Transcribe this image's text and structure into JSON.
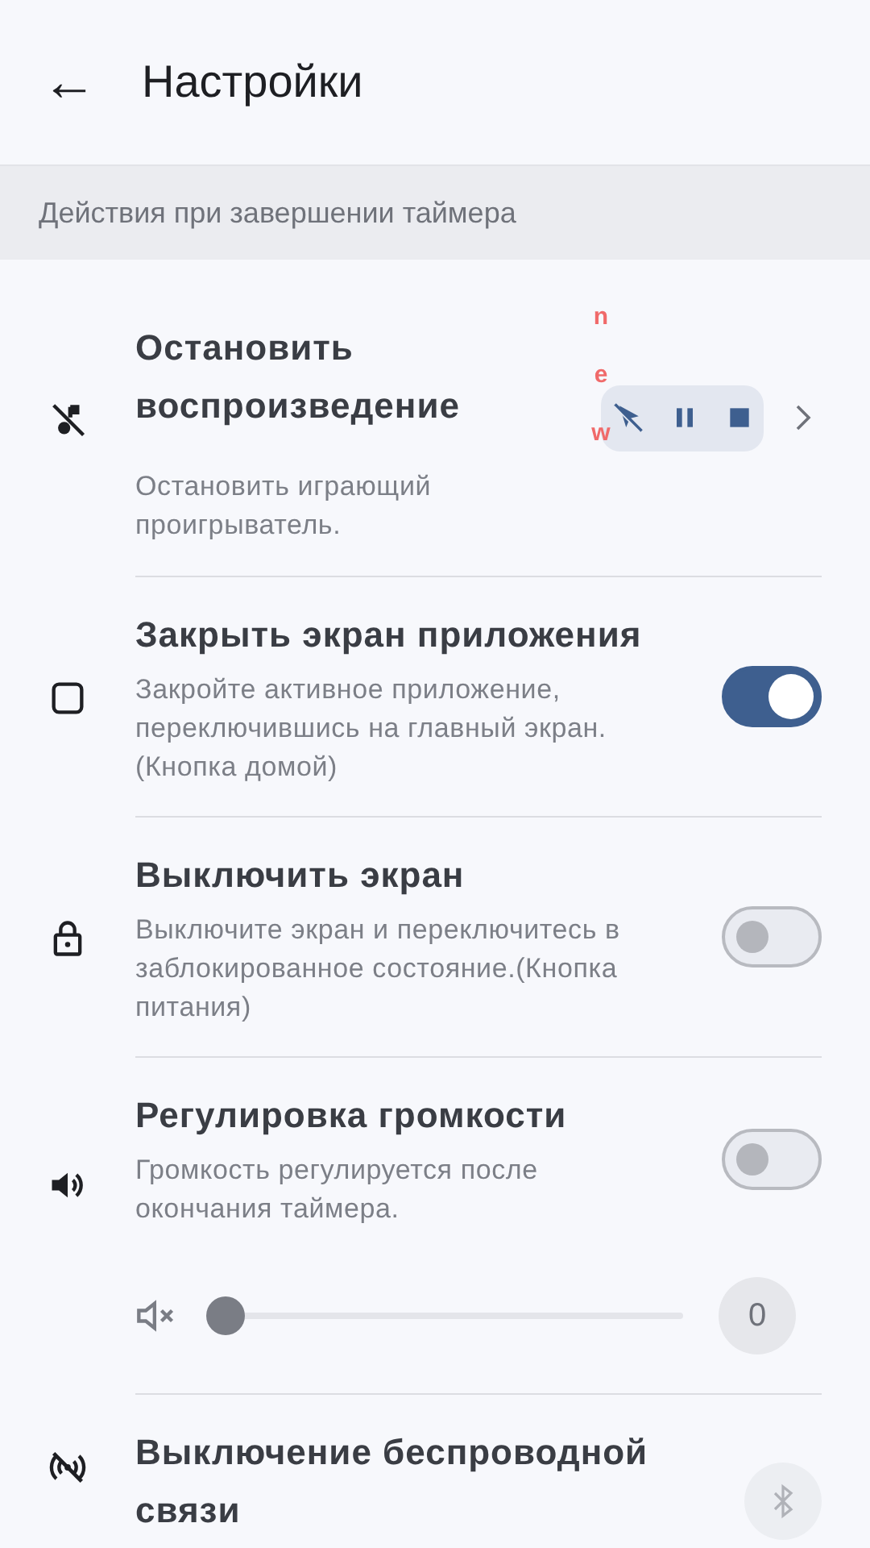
{
  "header": {
    "back": "←",
    "title": "Настройки"
  },
  "section": "Действия при завершении таймера",
  "items": [
    {
      "kind": "chips",
      "title": "Остановить воспроизведение",
      "description": "Остановить играющий проигрыватель.",
      "badge": "new"
    },
    {
      "kind": "toggle",
      "title": "Закрыть экран приложения",
      "description": "Закройте активное приложение, переключившись на главный экран.(Кнопка домой)",
      "on": true
    },
    {
      "kind": "toggle",
      "title": "Выключить экран",
      "description": "Выключите экран и переключитесь в заблокированное состояние.(Кнопка питания)",
      "on": false
    },
    {
      "kind": "toggle_slider",
      "title": "Регулировка громкости",
      "description": "Громкость регулируется после окончания таймера.",
      "on": false,
      "level": 0,
      "reading": "0"
    },
    {
      "kind": "button",
      "title": "Выключение беспроводной связи"
    }
  ]
}
